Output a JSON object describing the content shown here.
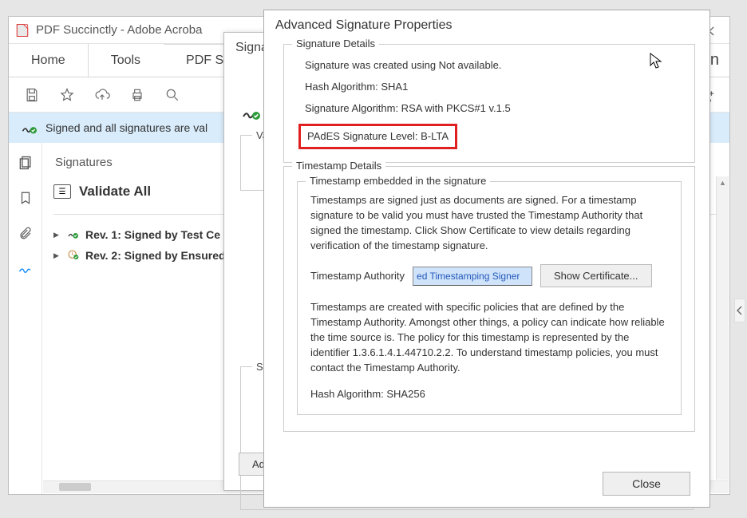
{
  "app": {
    "title": "PDF Succinctly - Adobe Acroba",
    "tabs": {
      "home": "Home",
      "tools": "Tools",
      "doc": "PDF Su"
    },
    "banner": "Signed and all signatures are val"
  },
  "signatures_panel": {
    "title": "Signatures",
    "validate_all": "Validate All",
    "rev1": "Rev. 1: Signed by Test Ce",
    "rev2": "Rev. 2: Signed by Ensured"
  },
  "mid_dialog": {
    "title": "Signat",
    "validity_legend": "Valid",
    "signer_legend": "Signe",
    "adv_button": "Adv"
  },
  "front_dialog": {
    "title": "Advanced Signature Properties",
    "sig_details_legend": "Signature Details",
    "sig_created": "Signature was created using Not available.",
    "hash_algo": "Hash Algorithm: SHA1",
    "sig_algo": "Signature Algorithm: RSA with PKCS#1 v.1.5",
    "pades_level": "PAdES Signature Level: B-LTA",
    "ts_details_legend": "Timestamp Details",
    "ts_embedded_legend": "Timestamp embedded in the signature",
    "ts_para1": "Timestamps are signed just as documents are signed. For a timestamp signature to be valid you must have trusted the Timestamp Authority that signed the timestamp. Click Show Certificate to view details regarding verification of the timestamp signature.",
    "ts_authority_label": "Timestamp Authority",
    "ts_authority_value": "ed Timestamping Signer",
    "show_cert": "Show Certificate...",
    "ts_para2": "Timestamps are created with specific policies that are defined by the Timestamp Authority. Amongst other things, a policy can indicate how reliable the time source is. The policy for this timestamp is represented by the identifier 1.3.6.1.4.1.44710.2.2. To understand timestamp policies, you must contact the Timestamp Authority.",
    "ts_hash": "Hash Algorithm: SHA256",
    "close": "Close"
  }
}
